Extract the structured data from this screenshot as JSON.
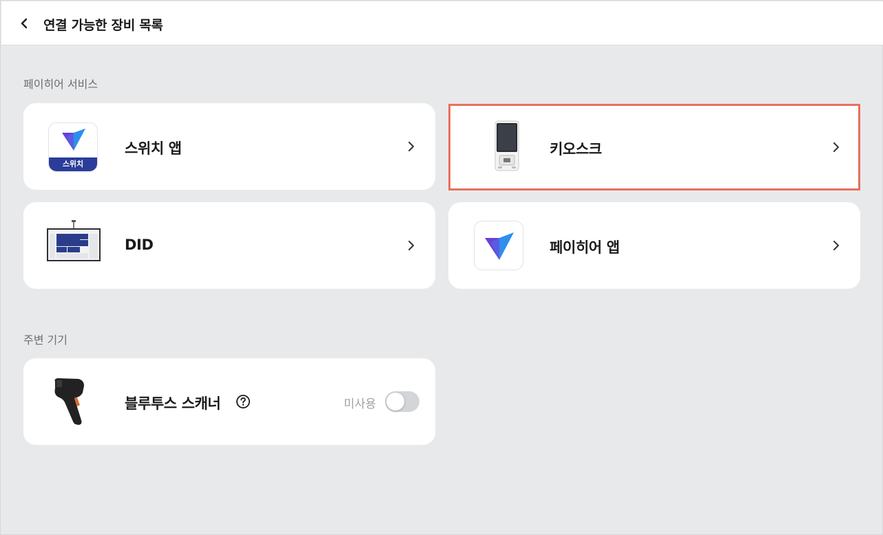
{
  "header": {
    "title": "연결 가능한 장비 목록",
    "back_icon": "chevron-left-icon"
  },
  "sections": {
    "payhere_service": {
      "label": "페이히어 서비스",
      "items": [
        {
          "label": "스위치 앱",
          "icon": "switch-app-icon",
          "icon_badge": "스위치"
        },
        {
          "label": "키오스크",
          "icon": "kiosk-device-image",
          "highlighted": true
        },
        {
          "label": "DID",
          "icon": "did-display-image"
        },
        {
          "label": "페이히어 앱",
          "icon": "payhere-app-icon"
        }
      ]
    },
    "peripherals": {
      "label": "주변 기기",
      "items": [
        {
          "label": "블루투스 스캐너",
          "icon": "barcode-scanner-image",
          "toggle_label": "미사용",
          "toggle_on": false
        }
      ]
    }
  },
  "colors": {
    "background": "#e8e9eb",
    "card": "#ffffff",
    "highlight_border": "#e8705f",
    "logo_blue": "#2e8ef0",
    "logo_purple": "#6a3fd8",
    "badge_navy": "#2b3d9a"
  }
}
